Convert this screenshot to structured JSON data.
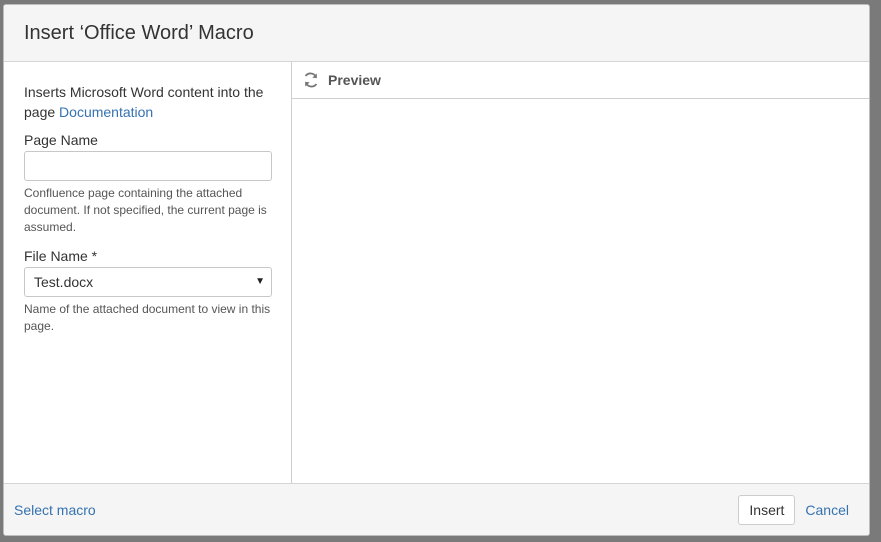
{
  "dialog": {
    "title": "Insert ‘Office Word’ Macro"
  },
  "left": {
    "description": "Inserts Microsoft Word content into the page ",
    "doc_link": "Documentation",
    "page_name": {
      "label": "Page Name",
      "value": "",
      "help": "Confluence page containing the attached document. If not specified, the current page is assumed."
    },
    "file_name": {
      "label": "File Name *",
      "value": "Test.docx",
      "help": "Name of the attached document to view in this page."
    }
  },
  "preview": {
    "label": "Preview",
    "icon": "refresh-icon"
  },
  "footer": {
    "select_macro": "Select macro",
    "insert": "Insert",
    "cancel": "Cancel"
  },
  "colors": {
    "link": "#3572b0",
    "header_bg": "#f5f5f5"
  }
}
